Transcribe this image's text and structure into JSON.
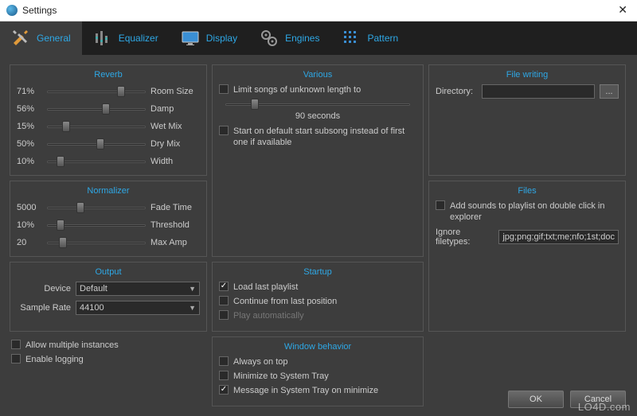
{
  "window": {
    "title": "Settings"
  },
  "tabs": [
    {
      "label": "General"
    },
    {
      "label": "Equalizer"
    },
    {
      "label": "Display"
    },
    {
      "label": "Engines"
    },
    {
      "label": "Pattern"
    }
  ],
  "reverb": {
    "title": "Reverb",
    "items": [
      {
        "value": "71%",
        "label": "Room Size",
        "pos": 71
      },
      {
        "value": "56%",
        "label": "Damp",
        "pos": 56
      },
      {
        "value": "15%",
        "label": "Wet Mix",
        "pos": 15
      },
      {
        "value": "50%",
        "label": "Dry Mix",
        "pos": 50
      },
      {
        "value": "10%",
        "label": "Width",
        "pos": 10
      }
    ]
  },
  "normalizer": {
    "title": "Normalizer",
    "items": [
      {
        "value": "5000",
        "label": "Fade Time",
        "pos": 30
      },
      {
        "value": "10%",
        "label": "Threshold",
        "pos": 10
      },
      {
        "value": "20",
        "label": "Max Amp",
        "pos": 12
      }
    ]
  },
  "output": {
    "title": "Output",
    "device_label": "Device",
    "device_value": "Default",
    "samplerate_label": "Sample Rate",
    "samplerate_value": "44100"
  },
  "bottom": {
    "allow_multi": "Allow multiple instances",
    "enable_logging": "Enable logging"
  },
  "various": {
    "title": "Various",
    "limit_label": "Limit songs of unknown length to",
    "limit_value": "90 seconds",
    "limit_slider_pos": 14,
    "start_default": "Start on default start subsong instead of first one if available"
  },
  "startup": {
    "title": "Startup",
    "load_last": "Load last playlist",
    "continue_pos": "Continue from last position",
    "play_auto": "Play automatically"
  },
  "window_behavior": {
    "title": "Window behavior",
    "always_top": "Always on top",
    "min_tray": "Minimize to System Tray",
    "msg_tray": "Message in System Tray on minimize"
  },
  "file_writing": {
    "title": "File writing",
    "directory_label": "Directory:",
    "directory_value": "",
    "browse": "..."
  },
  "files": {
    "title": "Files",
    "add_sounds": "Add sounds to playlist on double click in explorer",
    "ignore_label": "Ignore filetypes:",
    "ignore_value": "jpg;png;gif;txt;me;nfo;1st;doc"
  },
  "buttons": {
    "ok": "OK",
    "cancel": "Cancel"
  },
  "watermark": "LO4D.com"
}
